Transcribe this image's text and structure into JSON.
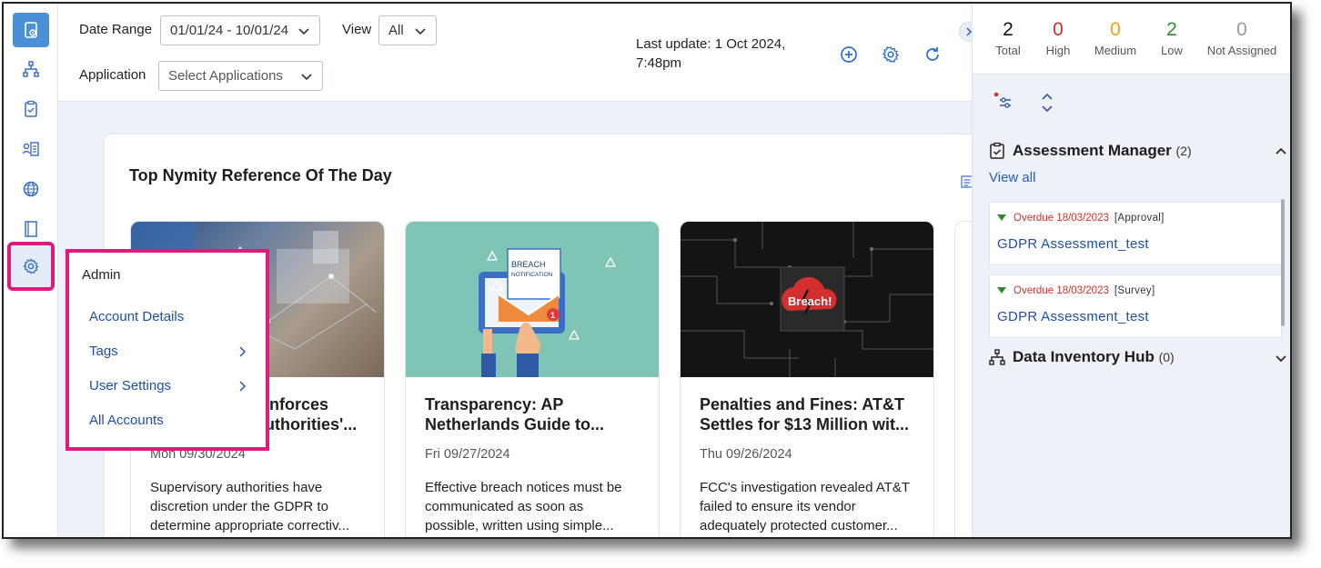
{
  "colors": {
    "accent": "#4a90d9",
    "highlight": "#e0197d",
    "link": "#1e4ea8",
    "high": "#d0312d",
    "medium": "#e8a317",
    "low": "#2e8b2e"
  },
  "sidebar": {
    "items": [
      {
        "icon": "home-dashboard-icon"
      },
      {
        "icon": "hierarchy-icon"
      },
      {
        "icon": "clipboard-check-icon"
      },
      {
        "icon": "user-list-icon"
      },
      {
        "icon": "globe-icon"
      },
      {
        "icon": "book-icon"
      },
      {
        "icon": "gear-icon"
      }
    ]
  },
  "toolbar": {
    "date_range_label": "Date Range",
    "date_range_value": "01/01/24 - 10/01/24",
    "view_label": "View",
    "view_value": "All",
    "application_label": "Application",
    "application_placeholder": "Select Applications",
    "last_update_line1": "Last update: 1 Oct 2024,",
    "last_update_line2": "7:48pm"
  },
  "panel": {
    "title": "Top Nymity Reference Of The Day",
    "cards": [
      {
        "title_line1": "inforces",
        "title_line2": "uthorities'...",
        "date": "Mon 09/30/2024",
        "desc": [
          "Supervisory authorities have",
          "discretion under the GDPR to",
          "determine appropriate correctiv..."
        ]
      },
      {
        "title_line1": "Transparency: AP",
        "title_line2": "Netherlands Guide to...",
        "date": "Fri 09/27/2024",
        "desc": [
          "Effective breach notices must be",
          "communicated as soon as",
          "possible, written using simple..."
        ],
        "img_text1": "BREACH",
        "img_text2": "NOTIFICATION",
        "img_badge": "1"
      },
      {
        "title_line1": "Penalties and Fines: AT&T",
        "title_line2": "Settles for $13 Million wit...",
        "date": "Thu 09/26/2024",
        "desc": [
          "FCC's investigation revealed AT&T",
          "failed to ensure its vendor",
          "adequately protected customer..."
        ],
        "img_text": "Breach!"
      }
    ]
  },
  "flyout": {
    "header": "Admin",
    "items": [
      "Account Details",
      "Tags",
      "User Settings",
      "All Accounts"
    ]
  },
  "stats": [
    {
      "value": "2",
      "label": "Total",
      "color": "#111111"
    },
    {
      "value": "0",
      "label": "High",
      "color": "#d0312d"
    },
    {
      "value": "0",
      "label": "Medium",
      "color": "#e8a317"
    },
    {
      "value": "2",
      "label": "Low",
      "color": "#2e8b2e"
    },
    {
      "value": "0",
      "label": "Not Assigned",
      "color": "#999999"
    }
  ],
  "assessment": {
    "title": "Assessment Manager",
    "count": "(2)",
    "view_all": "View all",
    "tasks": [
      {
        "overdue": "Overdue 18/03/2023",
        "type": "[Approval]",
        "name": "GDPR Assessment_test"
      },
      {
        "overdue": "Overdue 18/03/2023",
        "type": "[Survey]",
        "name": "GDPR Assessment_test"
      }
    ]
  },
  "data_inventory": {
    "title": "Data Inventory Hub",
    "count": "(0)"
  }
}
